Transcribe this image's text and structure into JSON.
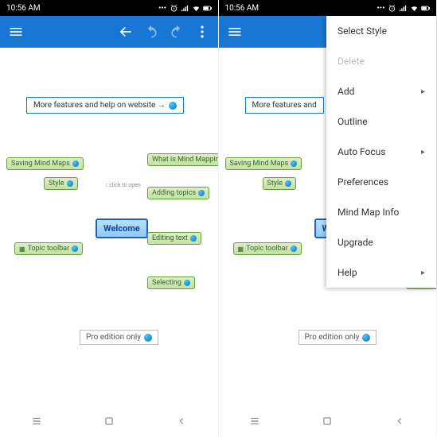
{
  "status": {
    "time": "10:56 AM"
  },
  "banner": {
    "text": "More features and help on website →"
  },
  "banner2": {
    "text": "More features and"
  },
  "nodes": {
    "root": "Welcome",
    "root2": "We",
    "save": "Saving Mind Maps",
    "style": "Style",
    "toolbar": "Topic toolbar",
    "whatis": "What is Mind Mapping",
    "adding": "Adding topics",
    "editing": "Editing text",
    "selecting": "Selecting",
    "clickopen": "click to\nopen"
  },
  "pro": {
    "text": "Pro edition only"
  },
  "menu": {
    "select_style": "Select Style",
    "delete": "Delete",
    "add": "Add",
    "outline": "Outline",
    "auto_focus": "Auto Focus",
    "preferences": "Preferences",
    "info": "Mind Map Info",
    "upgrade": "Upgrade",
    "help": "Help"
  }
}
